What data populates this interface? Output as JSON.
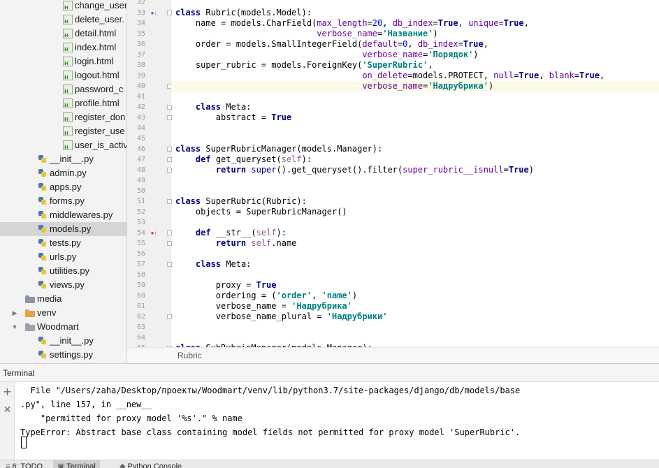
{
  "project_tree": [
    {
      "label": "change_user",
      "icon": "html-file-icon",
      "indent": 90,
      "selected": false
    },
    {
      "label": "delete_user.",
      "icon": "html-file-icon",
      "indent": 90,
      "selected": false
    },
    {
      "label": "detail.html",
      "icon": "html-file-icon",
      "indent": 90,
      "selected": false
    },
    {
      "label": "index.html",
      "icon": "html-file-icon",
      "indent": 90,
      "selected": false
    },
    {
      "label": "login.html",
      "icon": "html-file-icon",
      "indent": 90,
      "selected": false
    },
    {
      "label": "logout.html",
      "icon": "html-file-icon",
      "indent": 90,
      "selected": false
    },
    {
      "label": "password_c",
      "icon": "html-file-icon",
      "indent": 90,
      "selected": false
    },
    {
      "label": "profile.html",
      "icon": "html-file-icon",
      "indent": 90,
      "selected": false
    },
    {
      "label": "register_don",
      "icon": "html-file-icon",
      "indent": 90,
      "selected": false
    },
    {
      "label": "register_use",
      "icon": "html-file-icon",
      "indent": 90,
      "selected": false
    },
    {
      "label": "user_is_activ",
      "icon": "html-file-icon",
      "indent": 90,
      "selected": false
    },
    {
      "label": "__init__.py",
      "icon": "python-file-icon",
      "indent": 54,
      "selected": false
    },
    {
      "label": "admin.py",
      "icon": "python-file-icon",
      "indent": 54,
      "selected": false
    },
    {
      "label": "apps.py",
      "icon": "python-file-icon",
      "indent": 54,
      "selected": false
    },
    {
      "label": "forms.py",
      "icon": "python-file-icon",
      "indent": 54,
      "selected": false
    },
    {
      "label": "middlewares.py",
      "icon": "python-file-icon",
      "indent": 54,
      "selected": false
    },
    {
      "label": "models.py",
      "icon": "python-file-icon",
      "indent": 54,
      "selected": true
    },
    {
      "label": "tests.py",
      "icon": "python-file-icon",
      "indent": 54,
      "selected": false
    },
    {
      "label": "urls.py",
      "icon": "python-file-icon",
      "indent": 54,
      "selected": false
    },
    {
      "label": "utilities.py",
      "icon": "python-file-icon",
      "indent": 54,
      "selected": false
    },
    {
      "label": "views.py",
      "icon": "python-file-icon",
      "indent": 54,
      "selected": false
    },
    {
      "label": "media",
      "icon": "folder-icon",
      "indent": 36,
      "selected": false
    },
    {
      "label": "venv",
      "icon": "folder-orange-icon",
      "indent": 36,
      "arrow": "right",
      "selected": false
    },
    {
      "label": "Woodmart",
      "icon": "folder-open-icon",
      "indent": 36,
      "arrow": "down",
      "selected": false
    },
    {
      "label": "__init__.py",
      "icon": "python-file-icon",
      "indent": 54,
      "selected": false
    },
    {
      "label": "settings.py",
      "icon": "python-file-icon",
      "indent": 54,
      "selected": false
    }
  ],
  "editor": {
    "current_line": "40",
    "breadcrumb": "Rubric",
    "lines": [
      {
        "n": "32",
        "tokens": [],
        "mark": "",
        "fold": false
      },
      {
        "n": "33",
        "tokens": [
          [
            "kw",
            "class "
          ],
          [
            "",
            "Rubric(models.Model):"
          ]
        ],
        "mark": "override-icon",
        "fold": true
      },
      {
        "n": "34",
        "tokens": [
          [
            "",
            "    name = models.CharField("
          ],
          [
            "pr",
            "max_length"
          ],
          [
            "",
            "="
          ],
          [
            "nm",
            "20"
          ],
          [
            "",
            ", "
          ],
          [
            "pr",
            "db_index"
          ],
          [
            "",
            "="
          ],
          [
            "kw",
            "True"
          ],
          [
            "",
            ", "
          ],
          [
            "pr",
            "unique"
          ],
          [
            "",
            "="
          ],
          [
            "kw",
            "True"
          ],
          [
            "",
            ","
          ]
        ],
        "mark": "",
        "fold": false
      },
      {
        "n": "35",
        "tokens": [
          [
            "",
            "                            "
          ],
          [
            "pr",
            "verbose_name"
          ],
          [
            "",
            "="
          ],
          [
            "st",
            "'Название'"
          ],
          [
            "",
            ")"
          ]
        ],
        "mark": "",
        "fold": false
      },
      {
        "n": "36",
        "tokens": [
          [
            "",
            "    order = models.SmallIntegerField("
          ],
          [
            "pr",
            "default"
          ],
          [
            "",
            "="
          ],
          [
            "nm",
            "0"
          ],
          [
            "",
            ", "
          ],
          [
            "pr",
            "db_index"
          ],
          [
            "",
            "="
          ],
          [
            "kw",
            "True"
          ],
          [
            "",
            ","
          ]
        ],
        "mark": "",
        "fold": false
      },
      {
        "n": "37",
        "tokens": [
          [
            "",
            "                                     "
          ],
          [
            "pr",
            "verbose_name"
          ],
          [
            "",
            "="
          ],
          [
            "st",
            "'Порядок'"
          ],
          [
            "",
            ")"
          ]
        ],
        "mark": "",
        "fold": false
      },
      {
        "n": "38",
        "tokens": [
          [
            "",
            "    super_rubric = models.ForeignKey("
          ],
          [
            "st",
            "'SuperRubric'"
          ],
          [
            "",
            ","
          ]
        ],
        "mark": "",
        "fold": false
      },
      {
        "n": "39",
        "tokens": [
          [
            "",
            "                                     "
          ],
          [
            "pr",
            "on_delete"
          ],
          [
            "",
            "=models.PROTECT, "
          ],
          [
            "pr",
            "null"
          ],
          [
            "",
            "="
          ],
          [
            "kw",
            "True"
          ],
          [
            "",
            ", "
          ],
          [
            "pr",
            "blank"
          ],
          [
            "",
            "="
          ],
          [
            "kw",
            "True"
          ],
          [
            "",
            ","
          ]
        ],
        "mark": "",
        "fold": false
      },
      {
        "n": "40",
        "tokens": [
          [
            "",
            "                                     "
          ],
          [
            "pr",
            "verbose_name"
          ],
          [
            "",
            "="
          ],
          [
            "st",
            "'Надрубрика'"
          ],
          [
            "",
            ")"
          ]
        ],
        "mark": "",
        "fold": true
      },
      {
        "n": "41",
        "tokens": [],
        "mark": "",
        "fold": false
      },
      {
        "n": "42",
        "tokens": [
          [
            "",
            "    "
          ],
          [
            "kw",
            "class "
          ],
          [
            "",
            "Meta:"
          ]
        ],
        "mark": "",
        "fold": true
      },
      {
        "n": "43",
        "tokens": [
          [
            "",
            "        abstract = "
          ],
          [
            "kw",
            "True"
          ]
        ],
        "mark": "",
        "fold": true
      },
      {
        "n": "44",
        "tokens": [],
        "mark": "",
        "fold": false
      },
      {
        "n": "45",
        "tokens": [],
        "mark": "",
        "fold": false
      },
      {
        "n": "46",
        "tokens": [
          [
            "kw",
            "class "
          ],
          [
            "",
            "SuperRubricManager(models.Manager):"
          ]
        ],
        "mark": "",
        "fold": true
      },
      {
        "n": "47",
        "tokens": [
          [
            "",
            "    "
          ],
          [
            "kw",
            "def "
          ],
          [
            "",
            "get_queryset("
          ],
          [
            "sf",
            "self"
          ],
          [
            "",
            "):"
          ]
        ],
        "mark": "",
        "fold": true
      },
      {
        "n": "48",
        "tokens": [
          [
            "",
            "        "
          ],
          [
            "kw",
            "return "
          ],
          [
            "bi",
            "super"
          ],
          [
            "",
            "().get_queryset().filter("
          ],
          [
            "pr",
            "super_rubric__isnull"
          ],
          [
            "",
            "="
          ],
          [
            "kw",
            "True"
          ],
          [
            "",
            ")"
          ]
        ],
        "mark": "",
        "fold": true
      },
      {
        "n": "49",
        "tokens": [],
        "mark": "",
        "fold": false
      },
      {
        "n": "50",
        "tokens": [],
        "mark": "",
        "fold": false
      },
      {
        "n": "51",
        "tokens": [
          [
            "kw",
            "class "
          ],
          [
            "",
            "SuperRubric(Rubric):"
          ]
        ],
        "mark": "",
        "fold": true
      },
      {
        "n": "52",
        "tokens": [
          [
            "",
            "    objects = SuperRubricManager()"
          ]
        ],
        "mark": "",
        "fold": false
      },
      {
        "n": "53",
        "tokens": [],
        "mark": "",
        "fold": false
      },
      {
        "n": "54",
        "tokens": [
          [
            "",
            "    "
          ],
          [
            "kw",
            "def "
          ],
          [
            "",
            "__str__("
          ],
          [
            "sf",
            "self"
          ],
          [
            "",
            "):"
          ]
        ],
        "mark": "overridden-icon",
        "fold": true
      },
      {
        "n": "55",
        "tokens": [
          [
            "",
            "        "
          ],
          [
            "kw",
            "return "
          ],
          [
            "sf",
            "self"
          ],
          [
            "",
            ".name"
          ]
        ],
        "mark": "",
        "fold": true
      },
      {
        "n": "56",
        "tokens": [],
        "mark": "",
        "fold": false
      },
      {
        "n": "57",
        "tokens": [
          [
            "",
            "    "
          ],
          [
            "kw",
            "class "
          ],
          [
            "",
            "Meta:"
          ]
        ],
        "mark": "",
        "fold": true
      },
      {
        "n": "58",
        "tokens": [],
        "mark": "",
        "fold": false
      },
      {
        "n": "59",
        "tokens": [
          [
            "",
            "        proxy = "
          ],
          [
            "kw",
            "True"
          ]
        ],
        "mark": "",
        "fold": false
      },
      {
        "n": "60",
        "tokens": [
          [
            "",
            "        ordering = ("
          ],
          [
            "st",
            "'order'"
          ],
          [
            "",
            ", "
          ],
          [
            "st",
            "'name'"
          ],
          [
            "",
            ")"
          ]
        ],
        "mark": "",
        "fold": false
      },
      {
        "n": "61",
        "tokens": [
          [
            "",
            "        verbose_name = "
          ],
          [
            "st",
            "'Надрубрика'"
          ]
        ],
        "mark": "",
        "fold": false
      },
      {
        "n": "62",
        "tokens": [
          [
            "",
            "        verbose_name_plural = "
          ],
          [
            "st",
            "'Надрубрики'"
          ]
        ],
        "mark": "",
        "fold": true
      },
      {
        "n": "63",
        "tokens": [],
        "mark": "",
        "fold": false
      },
      {
        "n": "64",
        "tokens": [],
        "mark": "",
        "fold": false
      },
      {
        "n": "65",
        "tokens": [
          [
            "kw",
            "class "
          ],
          [
            "",
            "SubRubricManager(models.Manager):"
          ]
        ],
        "mark": "",
        "fold": true
      }
    ]
  },
  "terminal": {
    "title": "Terminal",
    "add_icon": "plus-icon",
    "close_icon": "close-icon",
    "lines": [
      "  File \"/Users/zaha/Desktop/проекты/Woodmart/venv/lib/python3.7/site-packages/django/db/models/base",
      ".py\", line 157, in __new__",
      "    \"permitted for proxy model '%s'.\" % name",
      "TypeError: Abstract base class containing model fields not permitted for proxy model 'SuperRubric'."
    ]
  },
  "tool_tabs": [
    {
      "label": "6: TODO",
      "icon": "todo-icon",
      "active": false
    },
    {
      "label": "Terminal",
      "icon": "terminal-icon",
      "active": true
    },
    {
      "label": "Python Console",
      "icon": "python-console-icon",
      "active": false
    }
  ],
  "colors": {
    "keyword": "#000080",
    "string": "#008080",
    "number": "#0000ff",
    "param": "#660099",
    "self": "#94558d",
    "selection": "#d5d5d5",
    "current_line": "#fcfbe6"
  }
}
